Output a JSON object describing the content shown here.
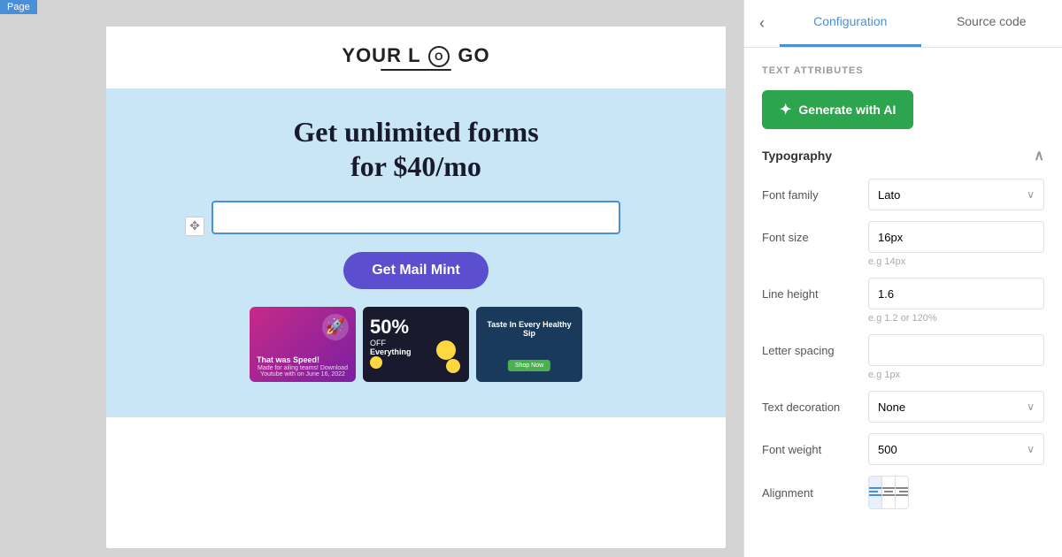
{
  "page": {
    "label": "Page"
  },
  "tabs": {
    "configuration": "Configuration",
    "source_code": "Source code"
  },
  "panel": {
    "text_attributes_label": "TEXT ATTRIBUTES",
    "generate_btn": "Generate with AI",
    "typography_title": "Typography",
    "font_family_label": "Font family",
    "font_family_value": "Lato",
    "font_size_label": "Font size",
    "font_size_value": "16px",
    "font_size_hint": "e.g 14px",
    "line_height_label": "Line height",
    "line_height_value": "1.6",
    "line_height_hint": "e.g 1.2 or 120%",
    "letter_spacing_label": "Letter spacing",
    "letter_spacing_value": "",
    "letter_spacing_hint": "e.g 1px",
    "text_decoration_label": "Text decoration",
    "text_decoration_value": "None",
    "font_weight_label": "Font weight",
    "font_weight_value": "500",
    "alignment_label": "Alignment"
  },
  "template": {
    "logo_text": "YOUR L",
    "logo_letter": "O",
    "logo_suffix": "GO",
    "hero_title_line1": "Get unlimited forms",
    "hero_title_line2": "for $40/mo",
    "cta_button": "Get Mail Mint",
    "preview_card_1_text": "That was Speed!",
    "preview_card_2_text": "50%",
    "preview_card_2_sub": "OFF",
    "preview_card_2_everything": "Everything",
    "preview_card_3_text": "Taste In Every Healthy Sip"
  },
  "icons": {
    "ai": "✦",
    "back": "‹",
    "chevron_down": "∨",
    "move": "✥",
    "collapse": "∧",
    "align_left": "≡",
    "align_center": "≡",
    "align_right": "≡"
  }
}
